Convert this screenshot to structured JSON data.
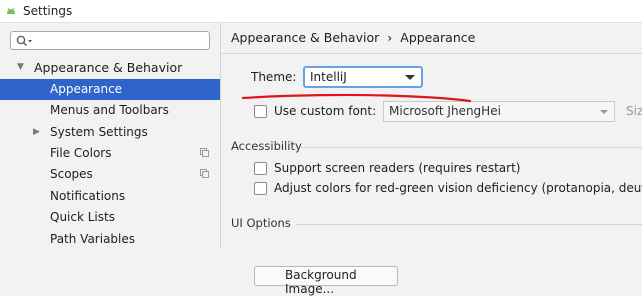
{
  "window": {
    "title": "Settings"
  },
  "sidebar": {
    "search_placeholder": "",
    "items": [
      {
        "label": "Appearance & Behavior",
        "expanded": true
      },
      {
        "label": "Appearance",
        "selected": true
      },
      {
        "label": "Menus and Toolbars"
      },
      {
        "label": "System Settings",
        "collapsed": true
      },
      {
        "label": "File Colors",
        "has_copy_icon": true
      },
      {
        "label": "Scopes",
        "has_copy_icon": true
      },
      {
        "label": "Notifications"
      },
      {
        "label": "Quick Lists"
      },
      {
        "label": "Path Variables"
      }
    ]
  },
  "main": {
    "breadcrumb": {
      "parent": "Appearance & Behavior",
      "separator": "›",
      "current": "Appearance"
    },
    "theme": {
      "label": "Theme:",
      "value": "IntelliJ"
    },
    "custom_font": {
      "label": "Use custom font:",
      "checked": false,
      "font_value": "Microsoft JhengHei",
      "size_label": "Siz"
    },
    "accessibility": {
      "title": "Accessibility",
      "options": [
        {
          "label": "Support screen readers (requires restart)",
          "checked": false
        },
        {
          "label": "Adjust colors for red-green vision deficiency (protanopia, deutera",
          "checked": false
        }
      ]
    },
    "ui_options": {
      "title": "UI Options",
      "button_label": "Background Image..."
    }
  },
  "colors": {
    "selection": "#2f65ca",
    "focus_border": "#6aa0e8",
    "annotation": "#e0141e"
  }
}
